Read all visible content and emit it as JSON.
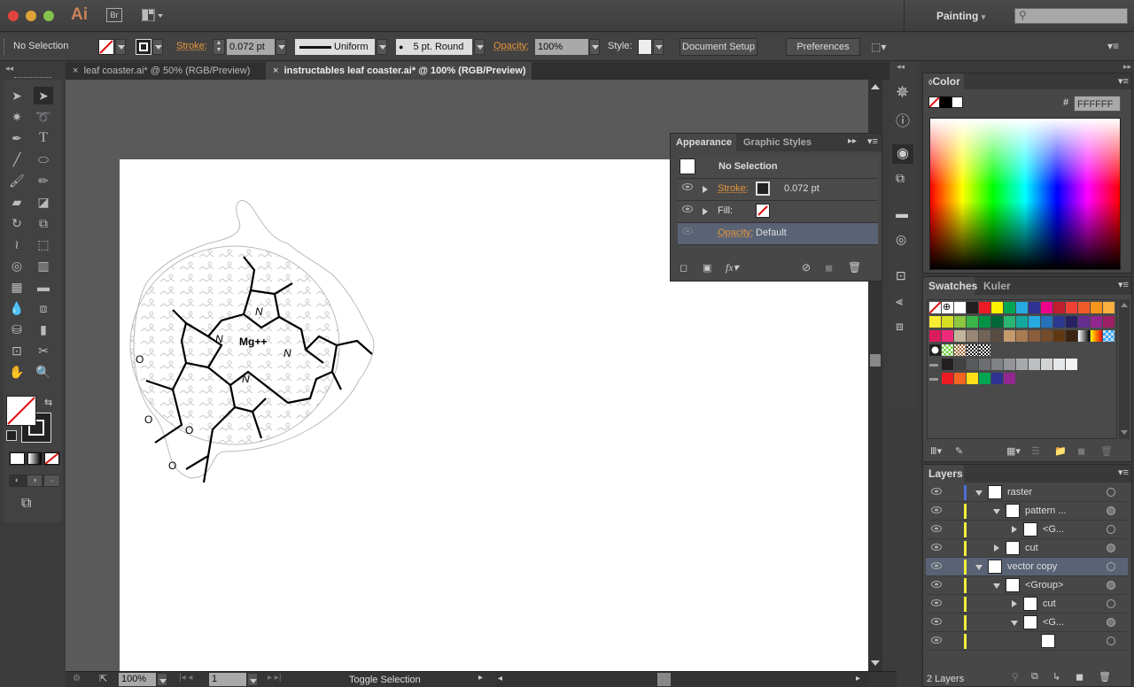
{
  "app": {
    "logo": "Ai",
    "bridge": "Br",
    "workspace": "Painting",
    "search_placeholder": ""
  },
  "control_bar": {
    "selection": "No Selection",
    "stroke_label": "Stroke:",
    "stroke_value": "0.072 pt",
    "profile": "Uniform",
    "brush": "5 pt. Round",
    "opacity_label": "Opacity:",
    "opacity_value": "100%",
    "style_label": "Style:",
    "document_setup": "Document Setup",
    "preferences": "Preferences"
  },
  "tabs": [
    {
      "label": "leaf coaster.ai* @ 50% (RGB/Preview)",
      "active": false
    },
    {
      "label": "instructables leaf coaster.ai* @ 100% (RGB/Preview)",
      "active": true
    }
  ],
  "artwork": {
    "atom_labels": [
      "N",
      "N",
      "N",
      "N",
      "Mg++",
      "O",
      "O",
      "O",
      "O",
      "O"
    ]
  },
  "appearance": {
    "tabs": [
      "Appearance",
      "Graphic Styles"
    ],
    "title": "No Selection",
    "stroke_label": "Stroke:",
    "stroke_value": "0.072 pt",
    "fill_label": "Fill:",
    "opacity_label": "Opacity:",
    "opacity_value": "Default"
  },
  "color_panel": {
    "title": "Color",
    "hex_label": "#",
    "hex_value": "FFFFFF"
  },
  "swatches": {
    "tabs": [
      "Swatches",
      "Kuler"
    ],
    "rows": [
      [
        "none",
        "registration",
        "#ffffff",
        "#231f20",
        "#ed1c24",
        "#fff200",
        "#00a651",
        "#27aae1",
        "#2e3192",
        "#ec008c",
        "#be1e2d",
        "#ef4136",
        "#f15a29",
        "#f7941d",
        "#fbb040"
      ],
      [
        "#f9ed32",
        "#d7df23",
        "#8dc63f",
        "#39b54a",
        "#009444",
        "#006838",
        "#2bb673",
        "#13a89e",
        "#27aae1",
        "#2672b8",
        "#2b3990",
        "#262262",
        "#662d91",
        "#92278f",
        "#9e1f63"
      ],
      [
        "#da1c5c",
        "#ee2a7b",
        "#c2b59b",
        "#998675",
        "#736357",
        "#594a42",
        "#c49a6c",
        "#a97c50",
        "#8b5e3c",
        "#754c29",
        "#603913",
        "#3c2415",
        "gradient-bw",
        "gradient-orange",
        "pattern-transparent"
      ],
      [
        "pattern-1",
        "pattern-2",
        "pattern-3",
        "pattern-4",
        "pattern-5"
      ],
      [
        "folder",
        "#231f20",
        "#414042",
        "#58595b",
        "#6d6e71",
        "#808285",
        "#939598",
        "#a7a9ac",
        "#bcbec0",
        "#d1d3d4",
        "#e6e7e8",
        "#f1f2f2"
      ],
      [
        "folder",
        "#ed1c24",
        "#f26522",
        "#ffde17",
        "#00a651",
        "#2e3192",
        "#92278f"
      ]
    ]
  },
  "layers": {
    "title": "Layers",
    "count": "2 Layers",
    "rows": [
      {
        "name": "raster",
        "indent": 0,
        "expanded": true,
        "color": "#4f6fd8",
        "selected": false
      },
      {
        "name": "pattern ...",
        "indent": 1,
        "expanded": true,
        "color": "#f0ef3a",
        "selected": false
      },
      {
        "name": "<G...",
        "indent": 2,
        "expanded": false,
        "color": "#f0ef3a",
        "selected": false
      },
      {
        "name": "cut",
        "indent": 1,
        "expanded": false,
        "color": "#f0ef3a",
        "selected": false
      },
      {
        "name": "vector copy",
        "indent": 0,
        "expanded": true,
        "color": "#f0ef3a",
        "selected": true
      },
      {
        "name": "<Group>",
        "indent": 1,
        "expanded": true,
        "color": "#f0ef3a",
        "selected": false
      },
      {
        "name": "cut",
        "indent": 2,
        "expanded": false,
        "color": "#f0ef3a",
        "selected": false
      },
      {
        "name": "<G...",
        "indent": 2,
        "expanded": true,
        "color": "#f0ef3a",
        "selected": false
      },
      {
        "name": "",
        "indent": 3,
        "expanded": null,
        "color": "#f0ef3a",
        "selected": false
      }
    ]
  },
  "statusbar": {
    "zoom": "100%",
    "artboard": "1",
    "status": "Toggle Selection"
  }
}
